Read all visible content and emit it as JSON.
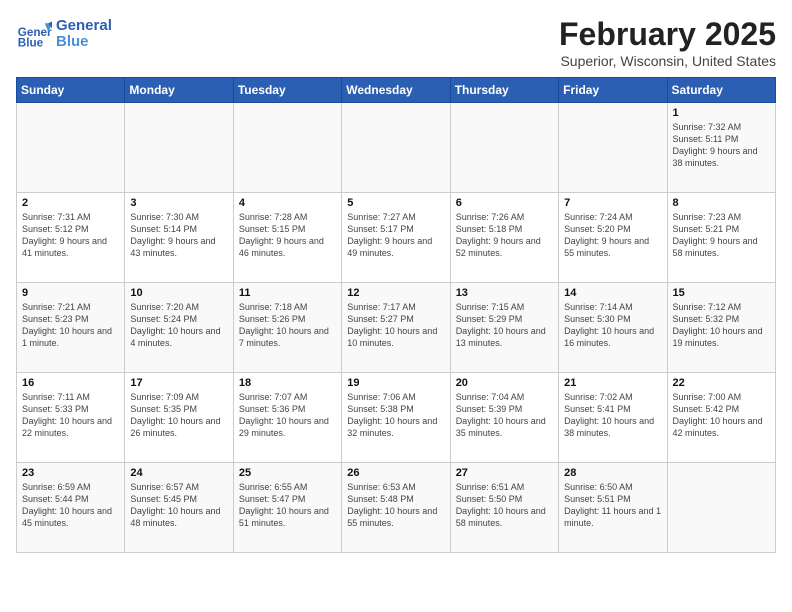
{
  "header": {
    "logo_line1": "General",
    "logo_line2": "Blue",
    "title": "February 2025",
    "subtitle": "Superior, Wisconsin, United States"
  },
  "columns": [
    "Sunday",
    "Monday",
    "Tuesday",
    "Wednesday",
    "Thursday",
    "Friday",
    "Saturday"
  ],
  "rows": [
    [
      {
        "day": "",
        "info": ""
      },
      {
        "day": "",
        "info": ""
      },
      {
        "day": "",
        "info": ""
      },
      {
        "day": "",
        "info": ""
      },
      {
        "day": "",
        "info": ""
      },
      {
        "day": "",
        "info": ""
      },
      {
        "day": "1",
        "info": "Sunrise: 7:32 AM\nSunset: 5:11 PM\nDaylight: 9 hours and 38 minutes."
      }
    ],
    [
      {
        "day": "2",
        "info": "Sunrise: 7:31 AM\nSunset: 5:12 PM\nDaylight: 9 hours and 41 minutes."
      },
      {
        "day": "3",
        "info": "Sunrise: 7:30 AM\nSunset: 5:14 PM\nDaylight: 9 hours and 43 minutes."
      },
      {
        "day": "4",
        "info": "Sunrise: 7:28 AM\nSunset: 5:15 PM\nDaylight: 9 hours and 46 minutes."
      },
      {
        "day": "5",
        "info": "Sunrise: 7:27 AM\nSunset: 5:17 PM\nDaylight: 9 hours and 49 minutes."
      },
      {
        "day": "6",
        "info": "Sunrise: 7:26 AM\nSunset: 5:18 PM\nDaylight: 9 hours and 52 minutes."
      },
      {
        "day": "7",
        "info": "Sunrise: 7:24 AM\nSunset: 5:20 PM\nDaylight: 9 hours and 55 minutes."
      },
      {
        "day": "8",
        "info": "Sunrise: 7:23 AM\nSunset: 5:21 PM\nDaylight: 9 hours and 58 minutes."
      }
    ],
    [
      {
        "day": "9",
        "info": "Sunrise: 7:21 AM\nSunset: 5:23 PM\nDaylight: 10 hours and 1 minute."
      },
      {
        "day": "10",
        "info": "Sunrise: 7:20 AM\nSunset: 5:24 PM\nDaylight: 10 hours and 4 minutes."
      },
      {
        "day": "11",
        "info": "Sunrise: 7:18 AM\nSunset: 5:26 PM\nDaylight: 10 hours and 7 minutes."
      },
      {
        "day": "12",
        "info": "Sunrise: 7:17 AM\nSunset: 5:27 PM\nDaylight: 10 hours and 10 minutes."
      },
      {
        "day": "13",
        "info": "Sunrise: 7:15 AM\nSunset: 5:29 PM\nDaylight: 10 hours and 13 minutes."
      },
      {
        "day": "14",
        "info": "Sunrise: 7:14 AM\nSunset: 5:30 PM\nDaylight: 10 hours and 16 minutes."
      },
      {
        "day": "15",
        "info": "Sunrise: 7:12 AM\nSunset: 5:32 PM\nDaylight: 10 hours and 19 minutes."
      }
    ],
    [
      {
        "day": "16",
        "info": "Sunrise: 7:11 AM\nSunset: 5:33 PM\nDaylight: 10 hours and 22 minutes."
      },
      {
        "day": "17",
        "info": "Sunrise: 7:09 AM\nSunset: 5:35 PM\nDaylight: 10 hours and 26 minutes."
      },
      {
        "day": "18",
        "info": "Sunrise: 7:07 AM\nSunset: 5:36 PM\nDaylight: 10 hours and 29 minutes."
      },
      {
        "day": "19",
        "info": "Sunrise: 7:06 AM\nSunset: 5:38 PM\nDaylight: 10 hours and 32 minutes."
      },
      {
        "day": "20",
        "info": "Sunrise: 7:04 AM\nSunset: 5:39 PM\nDaylight: 10 hours and 35 minutes."
      },
      {
        "day": "21",
        "info": "Sunrise: 7:02 AM\nSunset: 5:41 PM\nDaylight: 10 hours and 38 minutes."
      },
      {
        "day": "22",
        "info": "Sunrise: 7:00 AM\nSunset: 5:42 PM\nDaylight: 10 hours and 42 minutes."
      }
    ],
    [
      {
        "day": "23",
        "info": "Sunrise: 6:59 AM\nSunset: 5:44 PM\nDaylight: 10 hours and 45 minutes."
      },
      {
        "day": "24",
        "info": "Sunrise: 6:57 AM\nSunset: 5:45 PM\nDaylight: 10 hours and 48 minutes."
      },
      {
        "day": "25",
        "info": "Sunrise: 6:55 AM\nSunset: 5:47 PM\nDaylight: 10 hours and 51 minutes."
      },
      {
        "day": "26",
        "info": "Sunrise: 6:53 AM\nSunset: 5:48 PM\nDaylight: 10 hours and 55 minutes."
      },
      {
        "day": "27",
        "info": "Sunrise: 6:51 AM\nSunset: 5:50 PM\nDaylight: 10 hours and 58 minutes."
      },
      {
        "day": "28",
        "info": "Sunrise: 6:50 AM\nSunset: 5:51 PM\nDaylight: 11 hours and 1 minute."
      },
      {
        "day": "",
        "info": ""
      }
    ]
  ]
}
